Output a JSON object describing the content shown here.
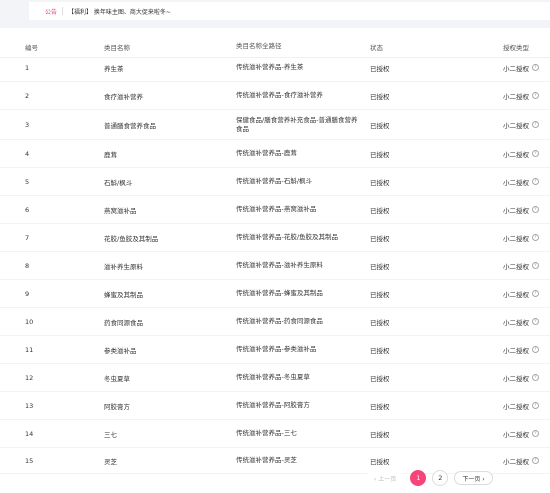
{
  "notice": {
    "label": "公告",
    "text": "【福利】 换年味主图、商大促来啦冬~"
  },
  "table": {
    "headers": [
      "编号",
      "类目名称",
      "类目名称全路径",
      "状态",
      "授权类型"
    ],
    "rows": [
      {
        "id": "1",
        "name": "养生茶",
        "path": "传统滋补营养品-养生茶",
        "status": "已授权",
        "auth": "小二授权"
      },
      {
        "id": "2",
        "name": "食疗滋补营养",
        "path": "传统滋补营养品-食疗滋补营养",
        "status": "已授权",
        "auth": "小二授权"
      },
      {
        "id": "3",
        "name": "普通膳食营养食品",
        "path": "保健食品/膳食营养补充食品-普通膳食营养食品",
        "status": "已授权",
        "auth": "小二授权"
      },
      {
        "id": "4",
        "name": "鹿茸",
        "path": "传统滋补营养品-鹿茸",
        "status": "已授权",
        "auth": "小二授权"
      },
      {
        "id": "5",
        "name": "石斛/枫斗",
        "path": "传统滋补营养品-石斛/枫斗",
        "status": "已授权",
        "auth": "小二授权"
      },
      {
        "id": "6",
        "name": "燕窝滋补品",
        "path": "传统滋补营养品-燕窝滋补品",
        "status": "已授权",
        "auth": "小二授权"
      },
      {
        "id": "7",
        "name": "花胶/鱼胶及其制品",
        "path": "传统滋补营养品-花胶/鱼胶及其制品",
        "status": "已授权",
        "auth": "小二授权"
      },
      {
        "id": "8",
        "name": "滋补养生原料",
        "path": "传统滋补营养品-滋补养生原料",
        "status": "已授权",
        "auth": "小二授权"
      },
      {
        "id": "9",
        "name": "蜂蜜及其制品",
        "path": "传统滋补营养品-蜂蜜及其制品",
        "status": "已授权",
        "auth": "小二授权"
      },
      {
        "id": "10",
        "name": "药食同源食品",
        "path": "传统滋补营养品-药食同源食品",
        "status": "已授权",
        "auth": "小二授权"
      },
      {
        "id": "11",
        "name": "参类滋补品",
        "path": "传统滋补营养品-参类滋补品",
        "status": "已授权",
        "auth": "小二授权"
      },
      {
        "id": "12",
        "name": "冬虫夏草",
        "path": "传统滋补营养品-冬虫夏草",
        "status": "已授权",
        "auth": "小二授权"
      },
      {
        "id": "13",
        "name": "阿胶膏方",
        "path": "传统滋补营养品-阿胶膏方",
        "status": "已授权",
        "auth": "小二授权"
      },
      {
        "id": "14",
        "name": "三七",
        "path": "传统滋补营养品-三七",
        "status": "已授权",
        "auth": "小二授权"
      },
      {
        "id": "15",
        "name": "灵芝",
        "path": "传统滋补营养品-灵芝",
        "status": "已授权",
        "auth": "小二授权"
      }
    ]
  },
  "pagination": {
    "prev": "‹ 上一页",
    "pages": [
      "1",
      "2"
    ],
    "current": "1",
    "next": "下一页 ›"
  },
  "colors": {
    "accent": "#f5457a",
    "notice_label": "#f0407a"
  },
  "icons": {
    "help": "question-circle-icon"
  }
}
